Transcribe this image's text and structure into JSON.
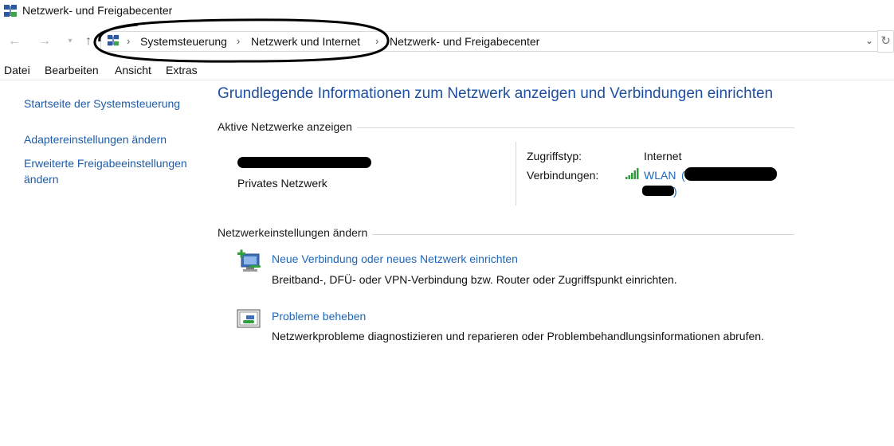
{
  "window": {
    "title": "Netzwerk- und Freigabecenter",
    "icon": "network-center-icon"
  },
  "nav": {
    "back_icon": "back-arrow-icon",
    "forward_icon": "forward-arrow-icon",
    "recent_icon": "chevron-down-icon",
    "up_icon": "up-arrow-icon"
  },
  "breadcrumb": {
    "items": [
      "Systemsteuerung",
      "Netzwerk und Internet",
      "Netzwerk- und Freigabecenter"
    ],
    "separator": "›",
    "dropdown_icon": "chevron-down-icon",
    "refresh_icon": "refresh-icon"
  },
  "menu": {
    "items": [
      "Datei",
      "Bearbeiten",
      "Ansicht",
      "Extras"
    ]
  },
  "sidebar": {
    "links": [
      "Startseite der Systemsteuerung",
      "Adaptereinstellungen ändern",
      "Erweiterte Freigabeeinstellungen ändern"
    ]
  },
  "main": {
    "title": "Grundlegende Informationen zum Netzwerk anzeigen und Verbindungen einrichten",
    "active": {
      "heading": "Aktive Netzwerke anzeigen",
      "network_type": "Privates Netzwerk",
      "access_label": "Zugriffstyp:",
      "access_value": "Internet",
      "connections_label": "Verbindungen:",
      "connection_name": "WLAN",
      "connection_paren_open": "(",
      "connection_paren_close": ")"
    },
    "change": {
      "heading": "Netzwerkeinstellungen ändern",
      "items": [
        {
          "title": "Neue Verbindung oder neues Netzwerk einrichten",
          "desc": "Breitband-, DFÜ- oder VPN-Verbindung bzw. Router oder Zugriffspunkt einrichten."
        },
        {
          "title": "Probleme beheben",
          "desc": "Netzwerkprobleme diagnostizieren und reparieren oder Problembehandlungsinformationen abrufen."
        }
      ]
    }
  },
  "colors": {
    "link": "#1e66b8",
    "title": "#1e4fa0",
    "signal": "#2e9e3e"
  }
}
